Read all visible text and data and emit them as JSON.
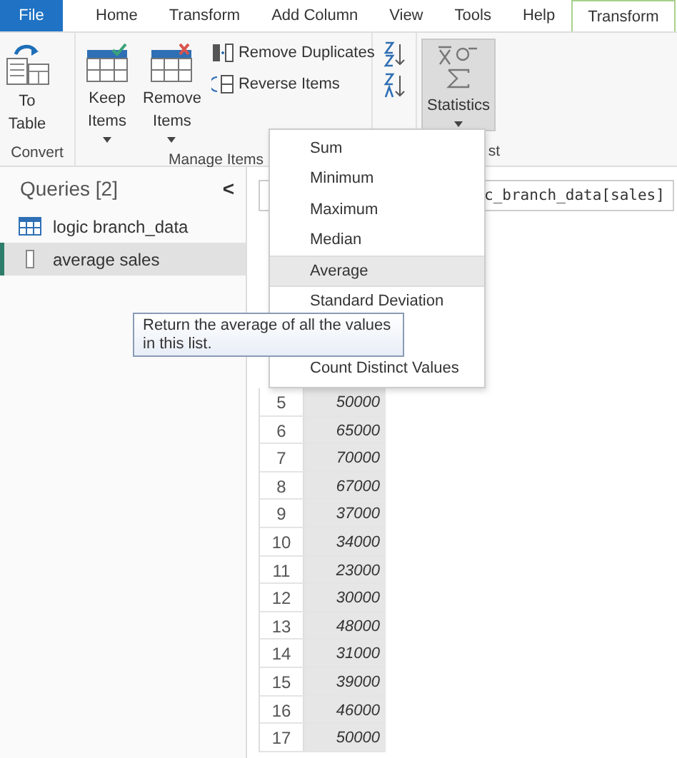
{
  "tabs": [
    {
      "label": "File",
      "kind": "file",
      "selected": false
    },
    {
      "label": "Home",
      "kind": "tab",
      "selected": false
    },
    {
      "label": "Transform",
      "kind": "tab",
      "selected": false
    },
    {
      "label": "Add Column",
      "kind": "tab",
      "selected": false
    },
    {
      "label": "View",
      "kind": "tab",
      "selected": false
    },
    {
      "label": "Tools",
      "kind": "tab",
      "selected": false
    },
    {
      "label": "Help",
      "kind": "tab",
      "selected": false
    },
    {
      "label": "Transform",
      "kind": "tab",
      "selected": true
    }
  ],
  "ribbon": {
    "convert": {
      "to_table": "To\nTable",
      "label": "Convert"
    },
    "manage": {
      "keep": "Keep\nItems",
      "remove": "Remove\nItems",
      "remove_duplicates": "Remove Duplicates",
      "reverse": "Reverse Items",
      "label": "Manage Items"
    },
    "statistics": {
      "label": "Statistics",
      "pressed": true,
      "group_label": "st"
    }
  },
  "queries": {
    "title": "Queries [2]",
    "collapse": "<",
    "items": [
      {
        "name": "logic branch_data",
        "kind": "table",
        "selected": false
      },
      {
        "name": "average sales",
        "kind": "list",
        "selected": true
      }
    ]
  },
  "formula": "c_branch_data[sales]",
  "menu": {
    "items": [
      {
        "label": "Sum",
        "selected": false
      },
      {
        "label": "Minimum",
        "selected": false
      },
      {
        "label": "Maximum",
        "selected": false
      },
      {
        "label": "Median",
        "selected": false
      },
      {
        "label": "Average",
        "selected": true
      },
      {
        "label": "Standard Deviation",
        "selected": false
      },
      {
        "label": "Count Distinct Values",
        "selected": false
      }
    ]
  },
  "tooltip": "Return the average of all the values in this list.",
  "rows": [
    {
      "n": "5",
      "value": "50000"
    },
    {
      "n": "6",
      "value": "65000"
    },
    {
      "n": "7",
      "value": "70000"
    },
    {
      "n": "8",
      "value": "67000"
    },
    {
      "n": "9",
      "value": "37000"
    },
    {
      "n": "10",
      "value": "34000"
    },
    {
      "n": "11",
      "value": "23000"
    },
    {
      "n": "12",
      "value": "30000"
    },
    {
      "n": "13",
      "value": "48000"
    },
    {
      "n": "14",
      "value": "31000"
    },
    {
      "n": "15",
      "value": "39000"
    },
    {
      "n": "16",
      "value": "46000"
    },
    {
      "n": "17",
      "value": "50000"
    }
  ]
}
